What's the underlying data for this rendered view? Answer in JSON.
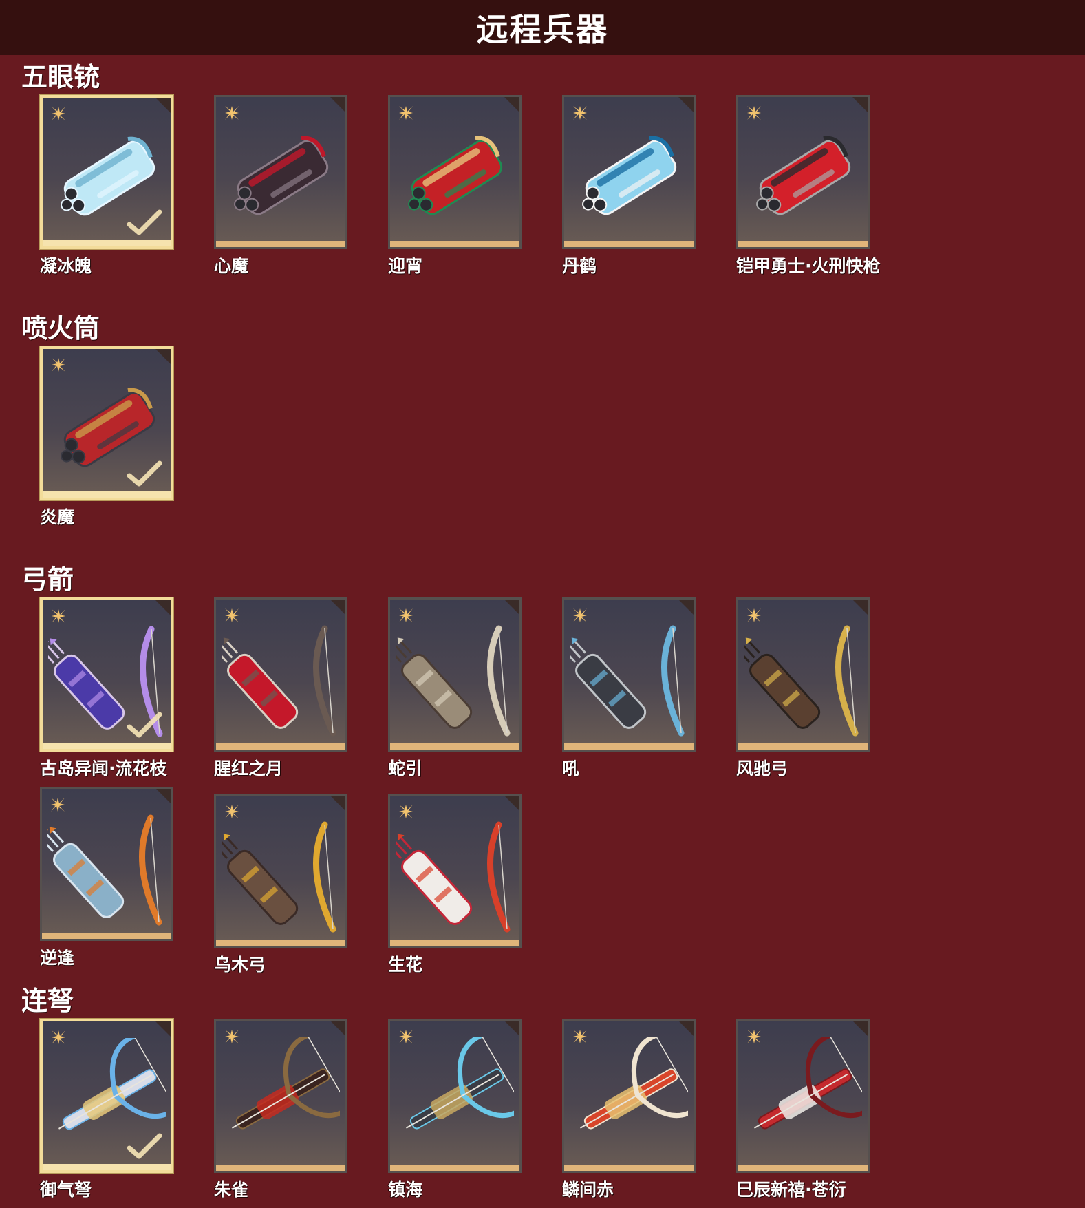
{
  "page": {
    "title": "远程兵器"
  },
  "colors": {
    "background": "#681a20",
    "title_bar": "#35100f",
    "card_equipped_border": "#f3dc9a",
    "card_strip": "#e0b57a",
    "rarity_icon": "#f2c36e"
  },
  "sections": [
    {
      "title": "五眼铳",
      "items": [
        {
          "name": "凝冰魄",
          "equipped": true,
          "palette": [
            "#bfe8f6",
            "#6fb2d0",
            "#e6f6ff"
          ]
        },
        {
          "name": "心魔",
          "equipped": false,
          "palette": [
            "#3a2a33",
            "#c0182a",
            "#8a7a86"
          ]
        },
        {
          "name": "迎宵",
          "equipped": false,
          "palette": [
            "#c42126",
            "#e6c27a",
            "#1f8a52"
          ]
        },
        {
          "name": "丹鹤",
          "equipped": false,
          "palette": [
            "#8fd3ee",
            "#1a6fa3",
            "#f4f4f4"
          ]
        },
        {
          "name": "铠甲勇士·火刑快枪",
          "equipped": false,
          "palette": [
            "#d3202a",
            "#2a2a2e",
            "#a8a8a8"
          ]
        }
      ]
    },
    {
      "title": "喷火筒",
      "items": [
        {
          "name": "炎魔",
          "equipped": true,
          "palette": [
            "#b8262a",
            "#c99a4a",
            "#3a3a44"
          ]
        }
      ]
    },
    {
      "title": "弓箭",
      "items": [
        {
          "name": "古岛异闻·流花枝",
          "equipped": true,
          "palette": [
            "#4b3aa8",
            "#b48de8",
            "#d7c6e8"
          ]
        },
        {
          "name": "腥红之月",
          "equipped": false,
          "palette": [
            "#c4182a",
            "#6a5a52",
            "#d8d0c4"
          ]
        },
        {
          "name": "蛇引",
          "equipped": false,
          "palette": [
            "#9a8c78",
            "#d6ccb8",
            "#4a3c34"
          ]
        },
        {
          "name": "吼",
          "equipped": false,
          "palette": [
            "#3a3c44",
            "#6ab2d8",
            "#c0c4c8"
          ]
        },
        {
          "name": "风驰弓",
          "equipped": false,
          "palette": [
            "#5a4030",
            "#d6b04a",
            "#2a221e"
          ]
        },
        {
          "name": "逆逢",
          "equipped": false,
          "palette": [
            "#8ab0c8",
            "#e07a2a",
            "#d8e4ee"
          ]
        },
        {
          "name": "乌木弓",
          "equipped": false,
          "palette": [
            "#6a5040",
            "#e0a830",
            "#3a2a26"
          ]
        },
        {
          "name": "生花",
          "equipped": false,
          "palette": [
            "#f0ece8",
            "#d8402a",
            "#c42638"
          ]
        }
      ]
    },
    {
      "title": "连弩",
      "items": [
        {
          "name": "御气弩",
          "equipped": true,
          "palette": [
            "#d8dce8",
            "#e6c87a",
            "#6ab2e8"
          ]
        },
        {
          "name": "朱雀",
          "equipped": false,
          "palette": [
            "#3a2420",
            "#c42a20",
            "#8a6a40"
          ]
        },
        {
          "name": "镇海",
          "equipped": false,
          "palette": [
            "#3a3c44",
            "#c8a860",
            "#6ac8e8"
          ]
        },
        {
          "name": "鳞间赤",
          "equipped": false,
          "palette": [
            "#d8452a",
            "#e8c070",
            "#f0e4d0"
          ]
        },
        {
          "name": "巳辰新禧·苍衍",
          "equipped": false,
          "palette": [
            "#c42a2e",
            "#f0ece8",
            "#7a1a1e"
          ]
        }
      ]
    }
  ]
}
